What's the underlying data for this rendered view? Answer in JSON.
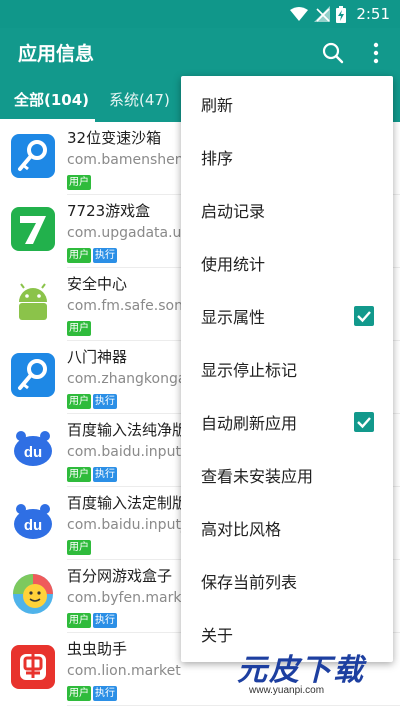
{
  "status_bar": {
    "time": "2:51"
  },
  "app_bar": {
    "title": "应用信息"
  },
  "tabs": [
    {
      "label": "全部(104)"
    },
    {
      "label": "系统(47)"
    }
  ],
  "apps": [
    {
      "name": "32位变速沙箱",
      "package": "com.bamenshenq",
      "badges": [
        "用户"
      ],
      "icon": "key-wrench-icon"
    },
    {
      "name": "7723游戏盒",
      "package": "com.upgadata.up",
      "badges": [
        "用户",
        "执行"
      ],
      "icon": "seven-logo-icon"
    },
    {
      "name": "安全中心",
      "package": "com.fm.safe.sony",
      "badges": [
        "用户"
      ],
      "icon": "android-icon"
    },
    {
      "name": "八门神器",
      "package": "com.zhangkongap",
      "badges": [
        "用户",
        "执行"
      ],
      "icon": "key-wrench-icon"
    },
    {
      "name": "百度输入法纯净版",
      "package": "com.baidu.input",
      "badges": [
        "用户",
        "执行"
      ],
      "icon": "baidu-du-icon"
    },
    {
      "name": "百度输入法定制版",
      "package": "com.baidu.input_c",
      "badges": [
        "用户"
      ],
      "icon": "baidu-du-icon"
    },
    {
      "name": "百分网游戏盒子",
      "package": "com.byfen.marke",
      "badges": [
        "用户",
        "执行"
      ],
      "icon": "smiley-icon"
    },
    {
      "name": "虫虫助手",
      "package": "com.lion.market",
      "badges": [
        "用户",
        "执行"
      ],
      "icon": "chongchong-icon"
    }
  ],
  "menu": {
    "items": [
      {
        "label": "刷新",
        "checked": false
      },
      {
        "label": "排序",
        "checked": false
      },
      {
        "label": "启动记录",
        "checked": false
      },
      {
        "label": "使用统计",
        "checked": false
      },
      {
        "label": "显示属性",
        "checked": true
      },
      {
        "label": "显示停止标记",
        "checked": false
      },
      {
        "label": "自动刷新应用",
        "checked": true
      },
      {
        "label": "查看未安装应用",
        "checked": false
      },
      {
        "label": "高对比风格",
        "checked": false
      },
      {
        "label": "保存当前列表",
        "checked": false
      },
      {
        "label": "关于",
        "checked": false
      }
    ]
  },
  "watermark": {
    "title": "元皮下载",
    "url": "www.yuanpi.com"
  },
  "colors": {
    "primary": "#12998c",
    "status_bar": "#10978a",
    "user_badge": "#2fbb3c",
    "exec_badge": "#2b8fe6"
  }
}
